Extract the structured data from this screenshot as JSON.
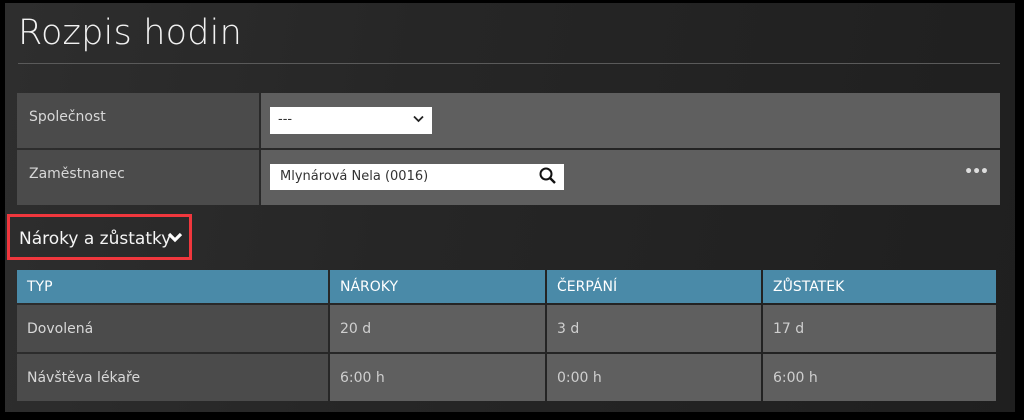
{
  "title": "Rozpis hodin",
  "form": {
    "company_label": "Společnost",
    "company_value": "---",
    "employee_label": "Zaměstnanec",
    "employee_value": "Mlynárová Nela (0016)",
    "more_label": "•••"
  },
  "section": {
    "label": "Nároky a zůstatky"
  },
  "table": {
    "headers": [
      "TYP",
      "NÁROKY",
      "ČERPÁNÍ",
      "ZŮSTATEK"
    ],
    "rows": [
      [
        "Dovolená",
        "20 d",
        "3 d",
        "17 d"
      ],
      [
        "Návštěva lékaře",
        "6:00 h",
        "0:00 h",
        "6:00 h"
      ]
    ]
  },
  "colors": {
    "header": "#4a8aa8",
    "highlight": "#f0373d"
  }
}
